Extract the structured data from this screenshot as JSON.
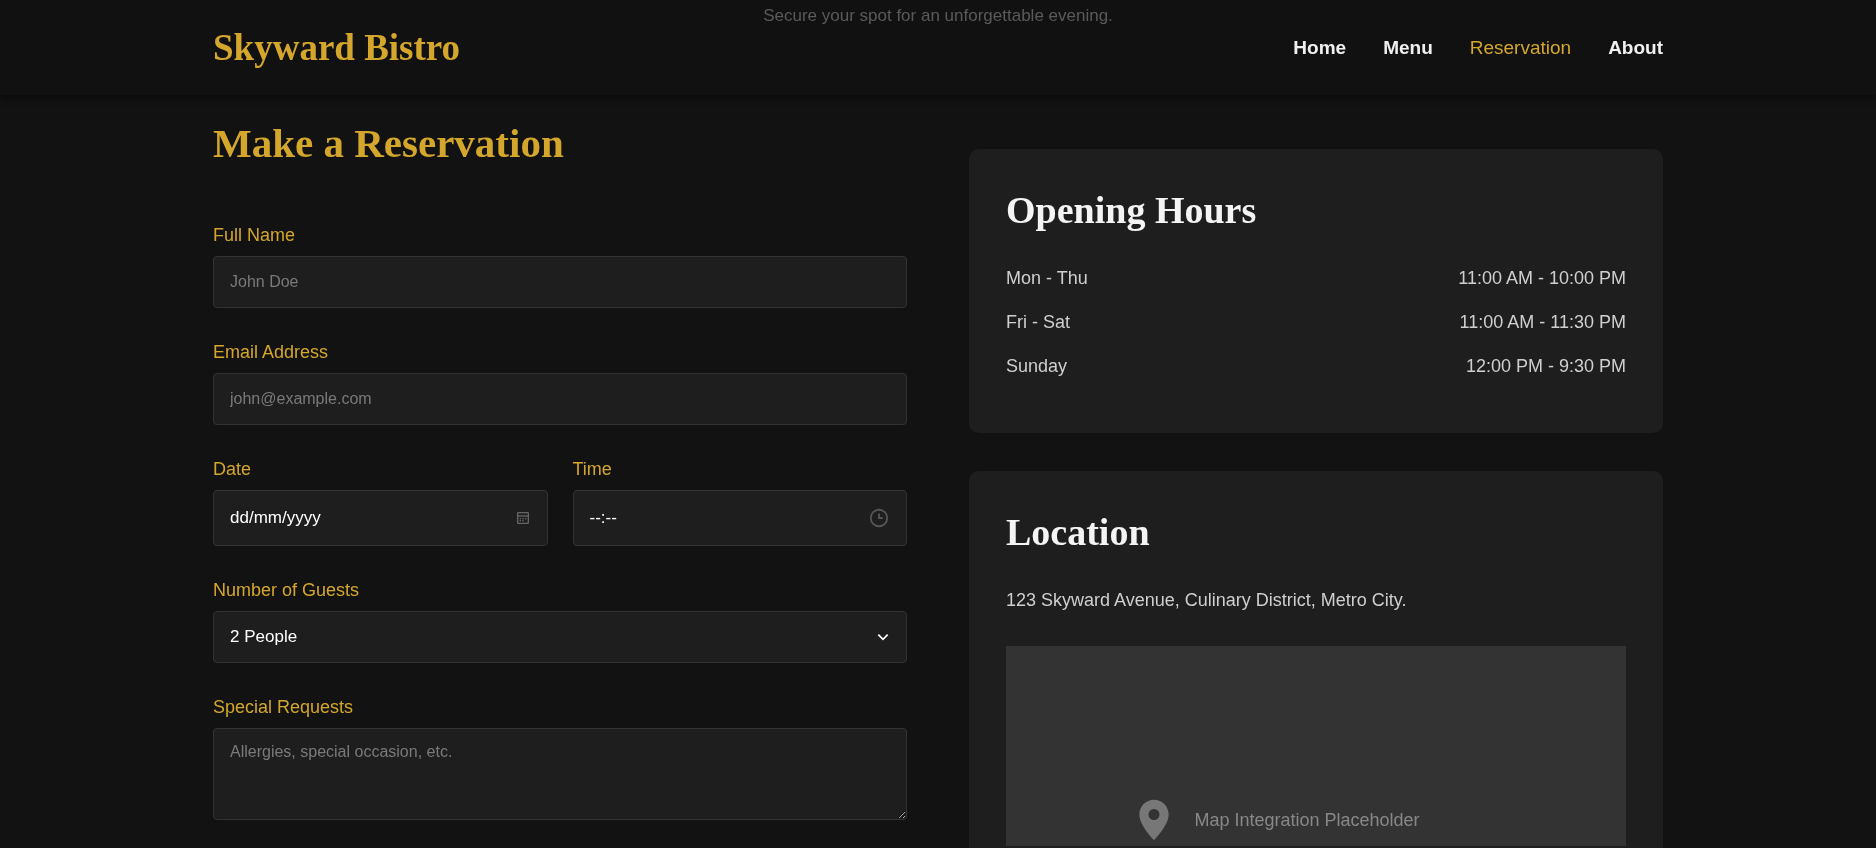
{
  "header": {
    "tagline": "Secure your spot for an unforgettable evening.",
    "logo": "Skyward Bistro",
    "nav": [
      {
        "label": "Home",
        "selected": false
      },
      {
        "label": "Menu",
        "selected": false
      },
      {
        "label": "Reservation",
        "selected": true
      },
      {
        "label": "About",
        "selected": false
      }
    ]
  },
  "form": {
    "title": "Make a Reservation",
    "fields": [
      {
        "kind": "text",
        "label": "Full Name",
        "placeholder": "John Doe"
      },
      {
        "kind": "text",
        "label": "Email Address",
        "placeholder": "john@example.com"
      },
      {
        "kind": "row",
        "fields": [
          {
            "kind": "date",
            "label": "Date",
            "value": "dd/mm/yyyy"
          },
          {
            "kind": "time",
            "label": "Time",
            "value": "--:--"
          }
        ]
      },
      {
        "kind": "select",
        "label": "Number of Guests",
        "value": "2 People"
      },
      {
        "kind": "textarea",
        "label": "Special Requests",
        "placeholder": "Allergies, special occasion, etc."
      }
    ]
  },
  "hours": {
    "title": "Opening Hours",
    "rows": [
      {
        "days": "Mon - Thu",
        "time": "11:00 AM - 10:00 PM"
      },
      {
        "days": "Fri - Sat",
        "time": "11:00 AM - 11:30 PM"
      },
      {
        "days": "Sunday",
        "time": "12:00 PM - 9:30 PM"
      }
    ]
  },
  "location": {
    "title": "Location",
    "address": "123 Skyward Avenue, Culinary District, Metro City.",
    "map": {
      "caption": "Map Integration Placeholder"
    }
  }
}
